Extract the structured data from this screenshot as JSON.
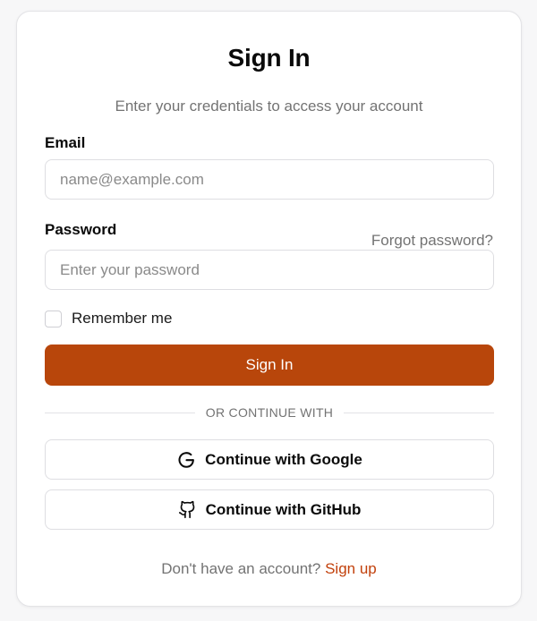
{
  "card": {
    "title": "Sign In",
    "subtitle": "Enter your credentials to access your account"
  },
  "email": {
    "label": "Email",
    "placeholder": "name@example.com",
    "value": ""
  },
  "password": {
    "label": "Password",
    "forgot_link": "Forgot password?",
    "placeholder": "Enter your password",
    "value": ""
  },
  "remember": {
    "label": "Remember me",
    "checked": false
  },
  "primary_button": {
    "label": "Sign In",
    "color": "#b8460b"
  },
  "divider": {
    "text": "OR CONTINUE WITH"
  },
  "social": {
    "google_label": "Continue with Google",
    "google_icon": "google-g-icon",
    "github_label": "Continue with GitHub",
    "github_icon": "github-icon"
  },
  "footer": {
    "prompt": "Don't have an account?",
    "link": "Sign up",
    "link_color": "#c2410c"
  }
}
